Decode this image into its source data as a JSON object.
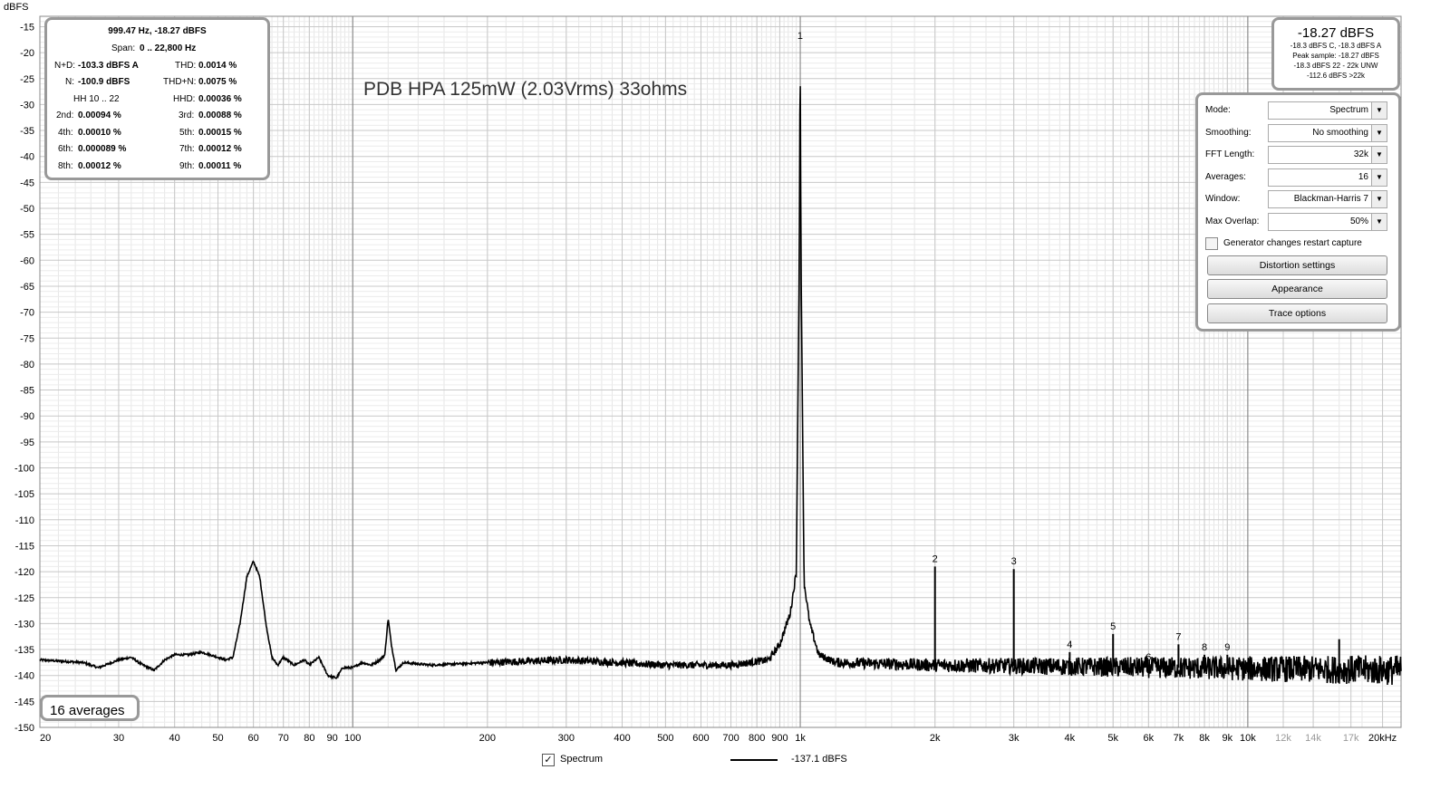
{
  "chart_data": {
    "type": "line",
    "title": "PDB HPA 125mW (2.03Vrms) 33ohms",
    "ylabel": "dBFS",
    "x_scale": "log",
    "xlim": [
      20,
      22000
    ],
    "ylim": [
      -150,
      -13
    ],
    "y_ticks": [
      -15,
      -20,
      -25,
      -30,
      -35,
      -40,
      -45,
      -50,
      -55,
      -60,
      -65,
      -70,
      -75,
      -80,
      -85,
      -90,
      -95,
      -100,
      -105,
      -110,
      -115,
      -120,
      -125,
      -130,
      -135,
      -140,
      -145,
      -150
    ],
    "x_ticks": [
      {
        "v": 20,
        "l": "20"
      },
      {
        "v": 30,
        "l": "30"
      },
      {
        "v": 40,
        "l": "40"
      },
      {
        "v": 50,
        "l": "50"
      },
      {
        "v": 60,
        "l": "60"
      },
      {
        "v": 70,
        "l": "70"
      },
      {
        "v": 80,
        "l": "80"
      },
      {
        "v": 90,
        "l": "90"
      },
      {
        "v": 100,
        "l": "100"
      },
      {
        "v": 200,
        "l": "200"
      },
      {
        "v": 300,
        "l": "300"
      },
      {
        "v": 400,
        "l": "400"
      },
      {
        "v": 500,
        "l": "500"
      },
      {
        "v": 600,
        "l": "600"
      },
      {
        "v": 700,
        "l": "700"
      },
      {
        "v": 800,
        "l": "800"
      },
      {
        "v": 900,
        "l": "900"
      },
      {
        "v": 1000,
        "l": "1k"
      },
      {
        "v": 2000,
        "l": "2k"
      },
      {
        "v": 3000,
        "l": "3k"
      },
      {
        "v": 4000,
        "l": "4k"
      },
      {
        "v": 5000,
        "l": "5k"
      },
      {
        "v": 6000,
        "l": "6k"
      },
      {
        "v": 7000,
        "l": "7k"
      },
      {
        "v": 8000,
        "l": "8k"
      },
      {
        "v": 9000,
        "l": "9k"
      },
      {
        "v": 10000,
        "l": "10k"
      },
      {
        "v": 12000,
        "l": "12k",
        "grey": true
      },
      {
        "v": 14000,
        "l": "14k",
        "grey": true
      },
      {
        "v": 17000,
        "l": "17k",
        "grey": true
      },
      {
        "v": 20000,
        "l": "20kHz"
      }
    ],
    "grid": true,
    "series": [
      {
        "values_description": "",
        "baseline": [
          [
            20,
            -137
          ],
          [
            25,
            -137.5
          ],
          [
            27,
            -138.5
          ],
          [
            30,
            -137
          ],
          [
            32,
            -136.5
          ],
          [
            34,
            -138
          ],
          [
            36,
            -139
          ],
          [
            38,
            -137
          ],
          [
            40,
            -136
          ],
          [
            43,
            -136
          ],
          [
            46,
            -135.5
          ],
          [
            50,
            -136.5
          ],
          [
            52,
            -137
          ],
          [
            54,
            -136.5
          ],
          [
            56,
            -130
          ],
          [
            58,
            -121
          ],
          [
            60,
            -118
          ],
          [
            62,
            -121
          ],
          [
            64,
            -130
          ],
          [
            66,
            -136.5
          ],
          [
            68,
            -138
          ],
          [
            70,
            -136.5
          ],
          [
            74,
            -138
          ],
          [
            78,
            -137
          ],
          [
            80,
            -138
          ],
          [
            84,
            -136.5
          ],
          [
            88,
            -140
          ],
          [
            92,
            -140.5
          ],
          [
            95,
            -138.5
          ],
          [
            100,
            -138.5
          ],
          [
            105,
            -137.5
          ],
          [
            110,
            -138
          ],
          [
            115,
            -137
          ],
          [
            118,
            -136
          ],
          [
            120,
            -129
          ],
          [
            122,
            -134
          ],
          [
            125,
            -139
          ],
          [
            130,
            -137.5
          ],
          [
            150,
            -138
          ],
          [
            200,
            -137.5
          ],
          [
            300,
            -137
          ],
          [
            500,
            -138
          ],
          [
            700,
            -138
          ],
          [
            850,
            -137
          ],
          [
            900,
            -134
          ],
          [
            950,
            -128
          ],
          [
            980,
            -120
          ],
          [
            995,
            -60
          ],
          [
            999.47,
            -18.27
          ],
          [
            1004,
            -60
          ],
          [
            1020,
            -122
          ],
          [
            1050,
            -130
          ],
          [
            1100,
            -136
          ],
          [
            1200,
            -137.5
          ],
          [
            2000,
            -138
          ],
          [
            22000,
            -139
          ]
        ],
        "peaks": [
          {
            "f": 999.47,
            "db": -18.27,
            "label": "1"
          },
          {
            "f": 2000,
            "db": -119,
            "label": "2"
          },
          {
            "f": 3000,
            "db": -119.5,
            "label": "3"
          },
          {
            "f": 4000,
            "db": -135.5,
            "label": "4"
          },
          {
            "f": 5000,
            "db": -132,
            "label": "5"
          },
          {
            "f": 6000,
            "db": -138,
            "label": "6"
          },
          {
            "f": 7000,
            "db": -134,
            "label": "7"
          },
          {
            "f": 8000,
            "db": -136,
            "label": "8"
          },
          {
            "f": 9000,
            "db": -136,
            "label": "9"
          },
          {
            "f": 16000,
            "db": -133,
            "label": ""
          }
        ]
      }
    ]
  },
  "measurements": {
    "header": "999.47 Hz, -18.27 dBFS",
    "span_label": "Span:",
    "span_value": "0 .. 22,800 Hz",
    "nd_label": "N+D:",
    "nd_value": "-103.3 dBFS A",
    "thd_label": "THD:",
    "thd_value": "0.0014 %",
    "n_label": "N:",
    "n_value": "-100.9 dBFS",
    "thdn_label": "THD+N:",
    "thdn_value": "0.0075 %",
    "hh_label": "HH 10 .. 22",
    "hhd_label": "HHD:",
    "hhd_value": "0.00036 %",
    "h2_label": "2nd:",
    "h2_value": "0.00094 %",
    "h3_label": "3rd:",
    "h3_value": "0.00088 %",
    "h4_label": "4th:",
    "h4_value": "0.00010 %",
    "h5_label": "5th:",
    "h5_value": "0.00015 %",
    "h6_label": "6th:",
    "h6_value": "0.000089 %",
    "h7_label": "7th:",
    "h7_value": "0.00012 %",
    "h8_label": "8th:",
    "h8_value": "0.00012 %",
    "h9_label": "9th:",
    "h9_value": "0.00011 %"
  },
  "level": {
    "main": "-18.27 dBFS",
    "line1": "-18.3 dBFS C, -18.3 dBFS A",
    "line2": "Peak sample: -18.27 dBFS",
    "line3": "-18.3 dBFS 22 - 22k UNW",
    "line4": "-112.6 dBFS >22k"
  },
  "controls": {
    "mode_label": "Mode:",
    "mode_value": "Spectrum",
    "smoothing_label": "Smoothing:",
    "smoothing_value": "No  smoothing",
    "fft_label": "FFT Length:",
    "fft_value": "32k",
    "averages_label": "Averages:",
    "averages_value": "16",
    "window_label": "Window:",
    "window_value": "Blackman-Harris 7",
    "overlap_label": "Max Overlap:",
    "overlap_value": "50%",
    "generator_label": "Generator changes restart capture",
    "distortion_button": "Distortion settings",
    "appearance_button": "Appearance",
    "trace_button": "Trace options"
  },
  "averages_box": "16 averages",
  "legend": {
    "checkbox_mark": "✓",
    "series_name": "Spectrum",
    "value": "-137.1 dBFS"
  }
}
